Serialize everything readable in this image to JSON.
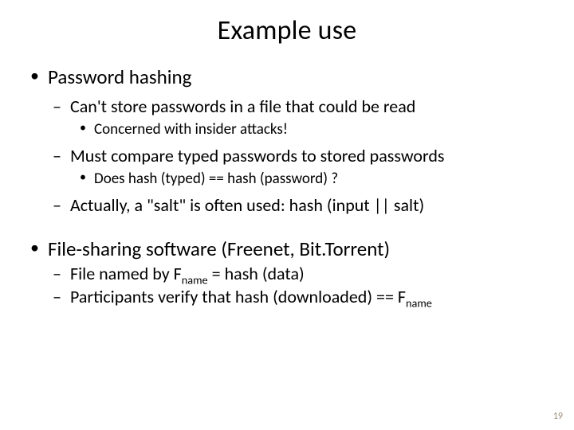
{
  "title": "Example use",
  "b1": {
    "text": "Password hashing",
    "s1": {
      "text": "Can't store passwords in a file that could be read",
      "ss1": "Concerned with insider attacks!"
    },
    "s2": {
      "text": "Must compare typed passwords to stored passwords",
      "ss1": "Does hash (typed) == hash (password) ?"
    },
    "s3": {
      "text": "Actually, a \"salt\" is often used:   hash (input || salt)"
    }
  },
  "b2": {
    "text": "File-sharing software (Freenet, Bit.Torrent)",
    "s1": {
      "pre": "File named by F",
      "sub": "name",
      "post": " = hash (data)"
    },
    "s2": {
      "pre": "Participants verify that  hash (downloaded) == F",
      "sub": "name"
    }
  },
  "page_number": "19"
}
